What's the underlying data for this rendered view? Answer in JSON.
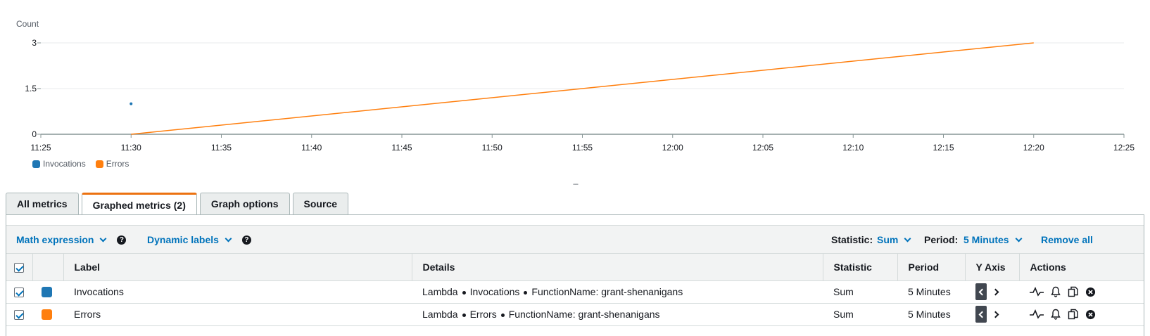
{
  "chart_data": {
    "type": "line",
    "ylabel": "Count",
    "ylim": [
      0,
      3
    ],
    "yticks": [
      "0",
      "1.5",
      "3"
    ],
    "xticks": [
      "11:25",
      "11:30",
      "11:35",
      "11:40",
      "11:45",
      "11:50",
      "11:55",
      "12:00",
      "12:05",
      "12:10",
      "12:15",
      "12:20",
      "12:25"
    ],
    "xrange": [
      "11:25",
      "12:25"
    ],
    "grid": true,
    "legend_position": "bottom-left",
    "series": [
      {
        "name": "Invocations",
        "color": "#1f77b4",
        "points": [
          {
            "x": "11:30",
            "y": 1
          }
        ]
      },
      {
        "name": "Errors",
        "color": "#ff7f0e",
        "points": [
          {
            "x": "11:30",
            "y": 0
          },
          {
            "x": "12:20",
            "y": 3
          }
        ]
      }
    ]
  },
  "legend": [
    {
      "label": "Invocations",
      "color": "#1f77b4"
    },
    {
      "label": "Errors",
      "color": "#ff7f0e"
    }
  ],
  "resize_handle": "---",
  "tabs": [
    {
      "label": "All metrics",
      "active": false
    },
    {
      "label": "Graphed metrics (2)",
      "active": true
    },
    {
      "label": "Graph options",
      "active": false
    },
    {
      "label": "Source",
      "active": false
    }
  ],
  "toolbar": {
    "math_expression": "Math expression",
    "dynamic_labels": "Dynamic labels",
    "statistic_label": "Statistic:",
    "statistic_value": "Sum",
    "period_label": "Period:",
    "period_value": "5 Minutes",
    "remove_all": "Remove all",
    "help_glyph": "?"
  },
  "table": {
    "headers": [
      "",
      "",
      "Label",
      "Details",
      "Statistic",
      "Period",
      "Y Axis",
      "Actions"
    ],
    "rows": [
      {
        "label": "Invocations",
        "color": "#1f77b4",
        "namespace": "Lambda",
        "metric": "Invocations",
        "dimension": "FunctionName: grant-shenanigans",
        "statistic": "Sum",
        "period": "5 Minutes"
      },
      {
        "label": "Errors",
        "color": "#ff7f0e",
        "namespace": "Lambda",
        "metric": "Errors",
        "dimension": "FunctionName: grant-shenanigans",
        "statistic": "Sum",
        "period": "5 Minutes"
      }
    ]
  },
  "icons": {
    "row_actions": [
      "graph-line-icon",
      "bell-icon",
      "copy-icon",
      "close-circle-icon"
    ]
  }
}
